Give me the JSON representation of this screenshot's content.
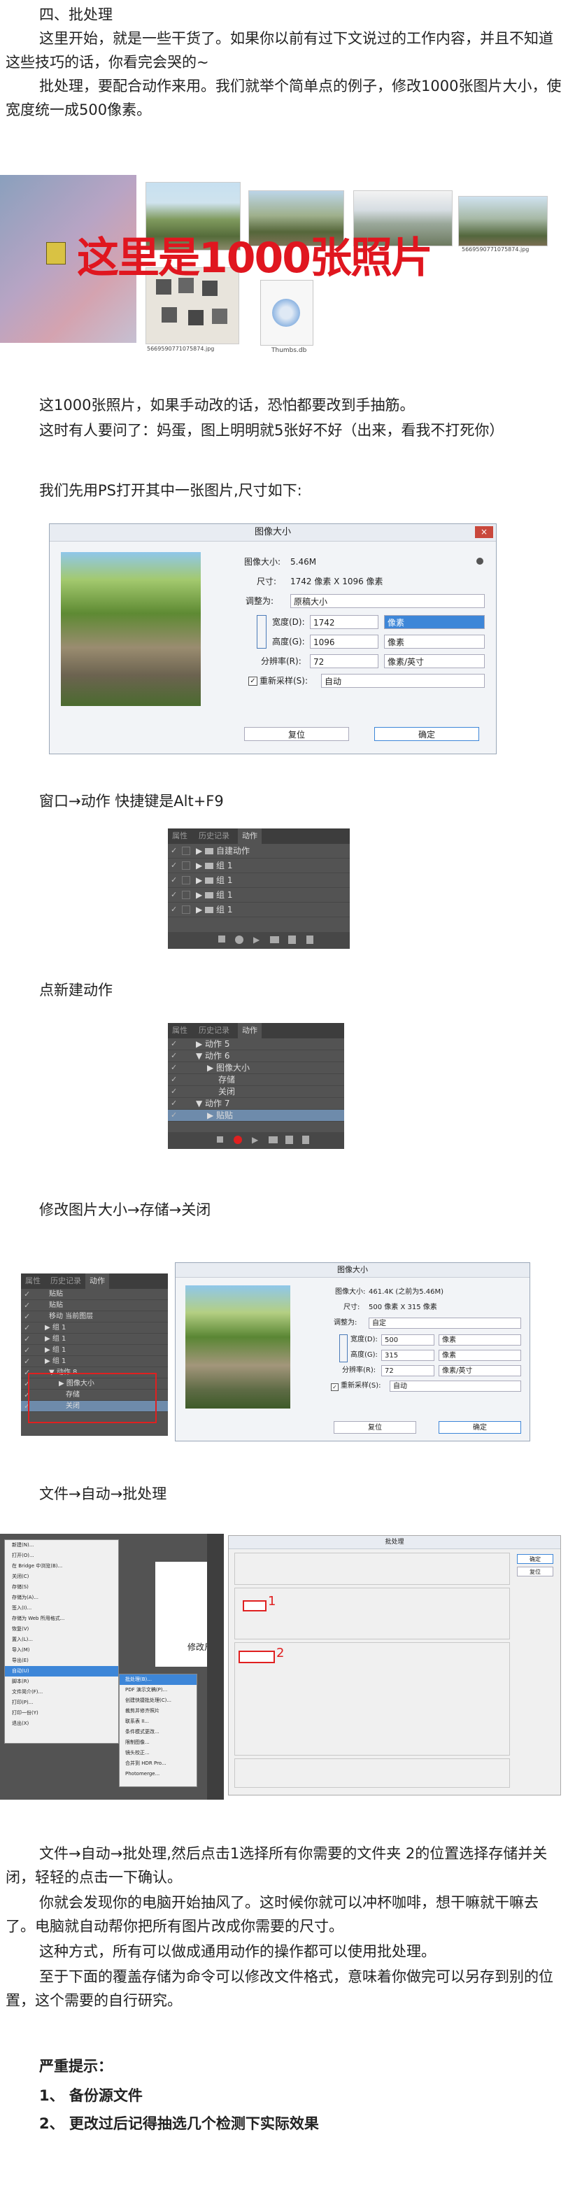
{
  "text": {
    "p1": "四、批处理",
    "p2": "这里开始，就是一些干货了。如果你以前有过下文说过的工作内容，并且不知道这些技巧的话，你看完会哭的~",
    "p3": "批处理，要配合动作来用。我们就举个简单点的例子，修改1000张图片大小，使宽度统一成500像素。",
    "overlay": "这里是1000张照片",
    "p4": "这1000张照片，如果手动改的话，恐怕都要改到手抽筋。",
    "p5": "这时有人要问了：妈蛋，图上明明就5张好不好（出来，看我不打死你）",
    "p6": "我们先用PS打开其中一张图片,尺寸如下:",
    "p7": "窗口→动作 快捷键是Alt+F9",
    "p8": "点新建动作",
    "p9": "修改图片大小→存储→关闭",
    "p10": "文件→自动→批处理",
    "p11": "文件→自动→批处理,然后点击1选择所有你需要的文件夹 2的位置选择存储并关闭，轻轻的点击一下确认。",
    "p12": "你就会发现你的电脑开始抽风了。这时候你就可以冲杯咖啡，想干嘛就干嘛去了。电脑就自动帮你把所有图片改成你需要的尺寸。",
    "p13": "这种方式，所有可以做成通用动作的操作都可以使用批处理。",
    "p14": "至于下面的覆盖存储为命令可以修改文件格式，意味着你做完可以另存到别的位置，这个需要的自行研究。",
    "p15": "严重提示：",
    "p16": "1、 备份源文件",
    "p17": "2、 更改过后记得抽选几个检测下实际效果"
  },
  "explorer": {
    "thumb_label": "Thumbs.db",
    "file_labels": [
      "5669590771075874.jpg",
      "5669590771075874.jpg"
    ]
  },
  "dialog1": {
    "title": "图像大小",
    "close": "×",
    "size_label": "图像大小:",
    "size_value": "5.46M",
    "dims_label": "尺寸:",
    "dims_value": "1742 像素 X 1096 像素",
    "fit_label": "调整为:",
    "fit_value": "原稿大小",
    "width_label": "宽度(D):",
    "width_value": "1742",
    "width_unit": "像素",
    "height_label": "高度(G):",
    "height_value": "1096",
    "height_unit": "像素",
    "res_label": "分辨率(R):",
    "res_value": "72",
    "res_unit": "像素/英寸",
    "resample_label": "重新采样(S):",
    "resample_value": "自动",
    "reset": "复位",
    "ok": "确定"
  },
  "actions1": {
    "tabs": [
      "属性",
      "历史记录",
      "动作"
    ],
    "rows": [
      "自建动作",
      "组 1",
      "组 1",
      "组 1",
      "组 1"
    ]
  },
  "actions2": {
    "tabs": [
      "属性",
      "历史记录",
      "动作"
    ],
    "rows": [
      "动作 5",
      "动作 6",
      "图像大小",
      "存储",
      "关闭",
      "动作 7",
      "贴贴"
    ]
  },
  "actions3": {
    "tabs": [
      "属性",
      "历史记录",
      "动作"
    ],
    "rows": [
      "贴贴",
      "贴贴",
      "移动 当前图层",
      "组 1",
      "组 1",
      "组 1",
      "组 1",
      "动作 8",
      "图像大小",
      "存储",
      "关闭"
    ]
  },
  "dialog2": {
    "title": "图像大小",
    "size_label": "图像大小:",
    "size_value": "461.4K (之前为5.46M)",
    "dims_label": "尺寸:",
    "dims_value": "500 像素 X 315 像素",
    "fit_label": "调整为:",
    "fit_value": "自定",
    "width_label": "宽度(D):",
    "width_value": "500",
    "width_unit": "像素",
    "height_label": "高度(G):",
    "height_value": "315",
    "height_unit": "像素",
    "res_label": "分辨率(R):",
    "res_value": "72",
    "res_unit": "像素/英寸",
    "resample_label": "重新采样(S):",
    "resample_value": "自动",
    "reset": "复位",
    "ok": "确定"
  },
  "batch": {
    "title": "批处理",
    "ok": "确定",
    "cancel": "复位",
    "marker1": "1",
    "marker2": "2",
    "menu_items": [
      "新建(N)...",
      "打开(O)...",
      "在 Bridge 中浏览(B)...",
      "关闭(C)",
      "存储(S)",
      "存储为(A)...",
      "签入(I)...",
      "存储为 Web 所用格式...",
      "恢复(V)",
      "置入(L)...",
      "导入(M)",
      "导出(E)",
      "自动(U)",
      "脚本(R)",
      "文件简介(F)...",
      "打印(P)...",
      "打印一份(Y)",
      "退出(X)"
    ],
    "submenu_items": [
      "批处理(B)...",
      "PDF 演示文稿(P)...",
      "创建快捷批处理(C)...",
      "裁剪并修齐照片",
      "联系表 II...",
      "条件模式更改...",
      "限制图像...",
      "镜头校正...",
      "合并到 HDR Pro...",
      "Photomerge..."
    ],
    "side_label": "修改尺"
  },
  "colors": {
    "overlay_text": "#e0161f",
    "highlight_red": "#e02020",
    "ps_panel": "#535353",
    "select_blue": "#3d86d8"
  }
}
